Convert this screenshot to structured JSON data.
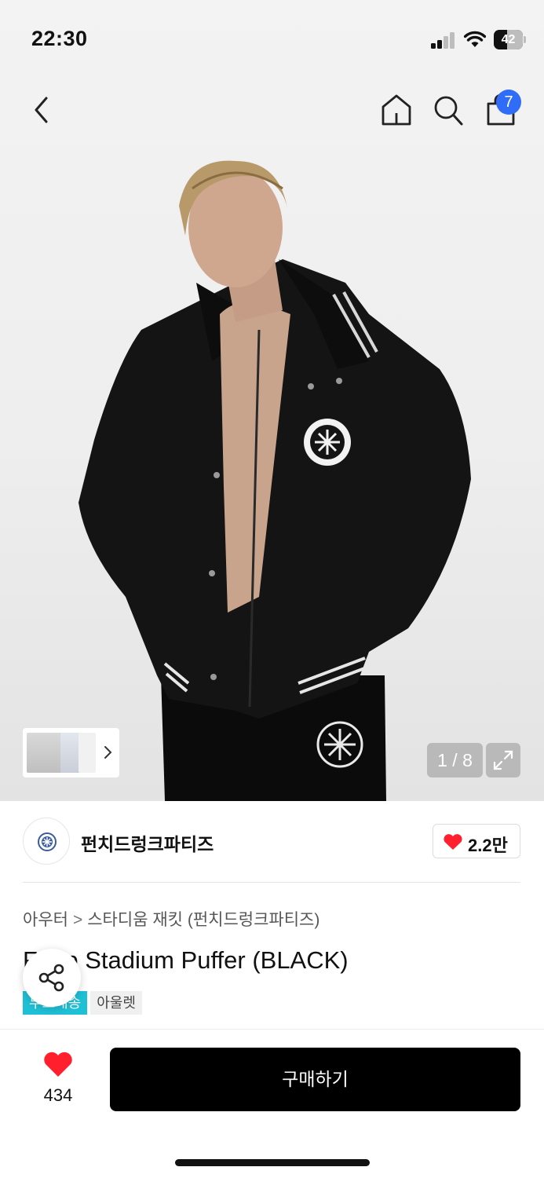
{
  "status_bar": {
    "time": "22:30",
    "battery": "42"
  },
  "header": {
    "cart_count": "7"
  },
  "gallery": {
    "counter": "1 / 8"
  },
  "brand": {
    "name": "펀치드렁크파티즈",
    "likes": "2.2만",
    "logo_text": "DRUNK PARTIES PUNCH"
  },
  "breadcrumb": {
    "category": "아우터",
    "subcategory": "스타디움 재킷 (펀치드렁크파티즈)"
  },
  "product": {
    "title": "F Zip Stadium Puffer (BLACK)",
    "tags": [
      "무료배송",
      "아울렛"
    ]
  },
  "bottom_bar": {
    "wish_count": "434",
    "buy_label": "구매하기"
  },
  "colors": {
    "accent_blue": "#2f6df6",
    "heart_red": "#ff1f2d",
    "tag_cyan": "#1ec0d6",
    "buy_bg": "#000000"
  }
}
